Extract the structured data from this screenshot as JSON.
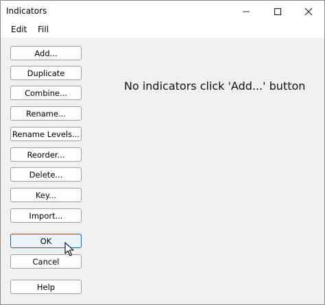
{
  "window": {
    "title": "Indicators"
  },
  "menu": {
    "items": [
      "Edit",
      "Fill"
    ]
  },
  "buttons": {
    "add": "Add...",
    "duplicate": "Duplicate",
    "combine": "Combine...",
    "rename": "Rename...",
    "rename_levels": "Rename Levels...",
    "reorder": "Reorder...",
    "delete": "Delete...",
    "key": "Key...",
    "import": "Import...",
    "ok": "OK",
    "cancel": "Cancel",
    "help": "Help"
  },
  "message": "No indicators click 'Add...' button"
}
